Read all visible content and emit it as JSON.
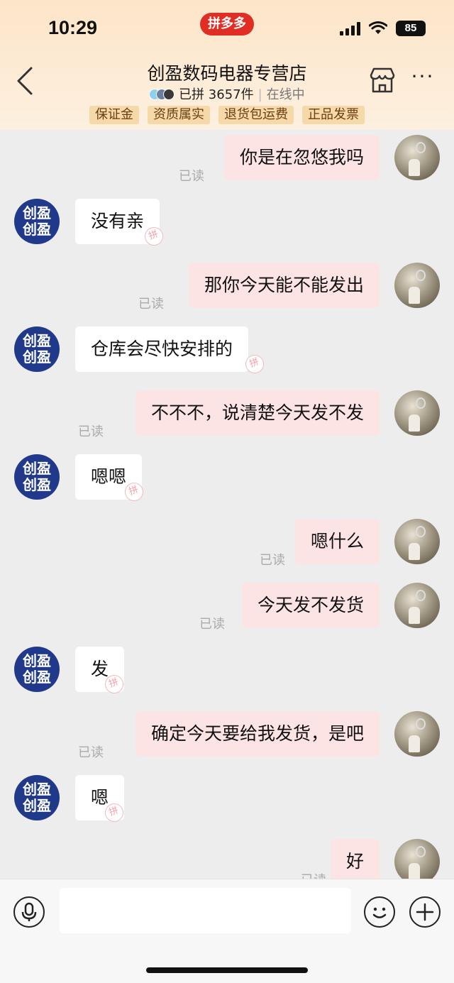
{
  "status_bar": {
    "time": "10:29",
    "app_badge": "拼多多",
    "battery": "85"
  },
  "header": {
    "shop_name": "创盈数码电器专营店",
    "sold_text": "已拼 3657件",
    "online_text": "在线中",
    "badges": [
      "保证金",
      "资质属实",
      "退货包运费",
      "正品发票"
    ]
  },
  "shop_avatar_text": "创盈\n创盈",
  "pin_mark": "拼",
  "read_label": "已读",
  "messages": [
    {
      "side": "out",
      "text": "你是在忽悠我吗",
      "read": "已读"
    },
    {
      "side": "in",
      "text": "没有亲"
    },
    {
      "side": "out",
      "text": "那你今天能不能发出",
      "read": "已读"
    },
    {
      "side": "in",
      "text": "仓库会尽快安排的"
    },
    {
      "side": "out",
      "text": "不不不，说清楚今天发不发",
      "read": "已读"
    },
    {
      "side": "in",
      "text": "嗯嗯"
    },
    {
      "side": "out",
      "text": "嗯什么",
      "read": "已读"
    },
    {
      "side": "out",
      "text": "今天发不发货",
      "read": "已读"
    },
    {
      "side": "in",
      "text": "发"
    },
    {
      "side": "out",
      "text": "确定今天要给我发货，是吧",
      "read": "已读"
    },
    {
      "side": "in",
      "text": "嗯"
    },
    {
      "side": "out",
      "text": "好",
      "read": "已读"
    }
  ],
  "input": {
    "value": "",
    "placeholder": ""
  },
  "colors": {
    "accent": "#e02e24",
    "out_bubble": "#fde4e4",
    "in_bubble": "#ffffff",
    "shop_avatar": "#21398a",
    "badge_bg": "#f6d9a8"
  }
}
